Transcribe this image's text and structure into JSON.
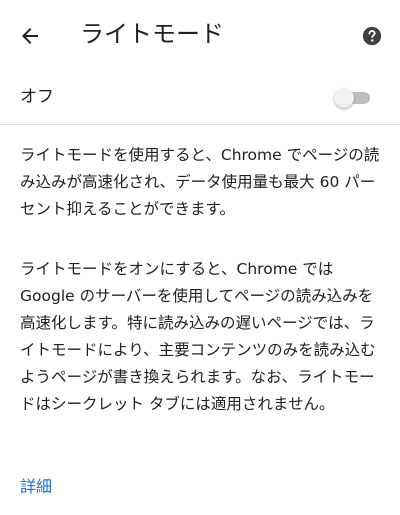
{
  "toolbar": {
    "title": "ライトモード",
    "back_icon": "arrow-back-icon",
    "help_icon": "help-circle-icon"
  },
  "setting": {
    "label": "オフ",
    "enabled": false
  },
  "content": {
    "paragraph1": "ライトモードを使用すると、Chrome でページの読み込みが高速化され、データ使用量も最大 60 パーセント抑えることができます。",
    "paragraph2": "ライトモードをオンにすると、Chrome では Google のサーバーを使用してページの読み込みを高速化します。特に読み込みの遅いページでは、ライトモードにより、主要コンテンツのみを読み込むようページが書き換えられます。なお、ライトモードはシークレット タブには適用されません。"
  },
  "footer": {
    "details_link": "詳細"
  },
  "colors": {
    "link": "#1a73e8",
    "text": "#202124",
    "divider": "#dadce0"
  }
}
